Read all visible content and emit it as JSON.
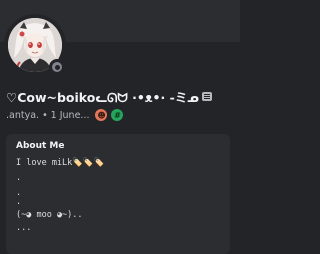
{
  "profile": {
    "display_name": "♡Cow~boikoᓚᘏᗢ ·•ᴥ•· -ミᓄ",
    "username": ".antya.",
    "joined": "1 June...",
    "separator": "•",
    "badges": [
      "badge-orange",
      "badge-green-hash"
    ],
    "badge_glyphs": [
      "☻",
      "#"
    ],
    "status": "offline"
  },
  "about": {
    "title": "About Me",
    "lines": [
      "I love miLk🏷️🏷️🏷️",
      ".",
      ".",
      ".",
      "(~◕ moo ◕~)..",
      "..."
    ]
  },
  "colors": {
    "background": "#232428",
    "card": "#2b2d31",
    "status_offline": "#80848e",
    "badge_orange": "#e4755b",
    "badge_green": "#23a55a"
  }
}
